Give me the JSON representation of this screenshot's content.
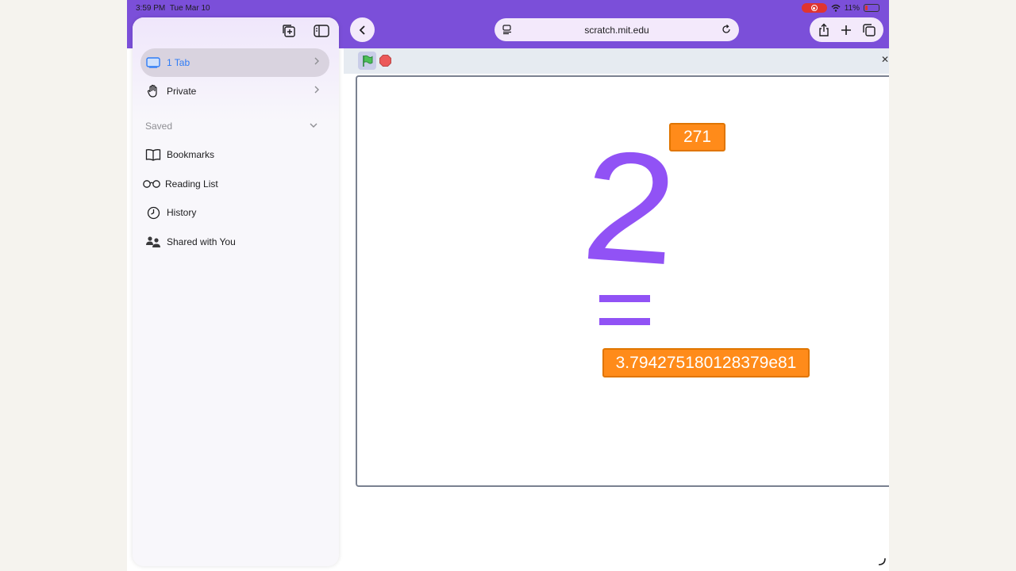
{
  "status": {
    "time": "3:59 PM",
    "date": "Tue Mar 10",
    "battery": "11%"
  },
  "sidebar": {
    "tabs_label": "1 Tab",
    "private_label": "Private",
    "section_saved": "Saved",
    "items": [
      {
        "label": "Bookmarks",
        "icon": "book-icon"
      },
      {
        "label": "Reading List",
        "icon": "glasses-icon"
      },
      {
        "label": "History",
        "icon": "clock-icon"
      },
      {
        "label": "Shared with You",
        "icon": "people-icon"
      }
    ]
  },
  "browser": {
    "url": "scratch.mit.edu"
  },
  "scratch": {
    "base": "2",
    "exponent": "271",
    "result": "3.794275180128379e81"
  },
  "colors": {
    "accent": "#7b4fd9",
    "scratch_purple": "#9152f5",
    "monitor_orange": "#ff8b1a",
    "link_blue": "#2f7cf6"
  }
}
